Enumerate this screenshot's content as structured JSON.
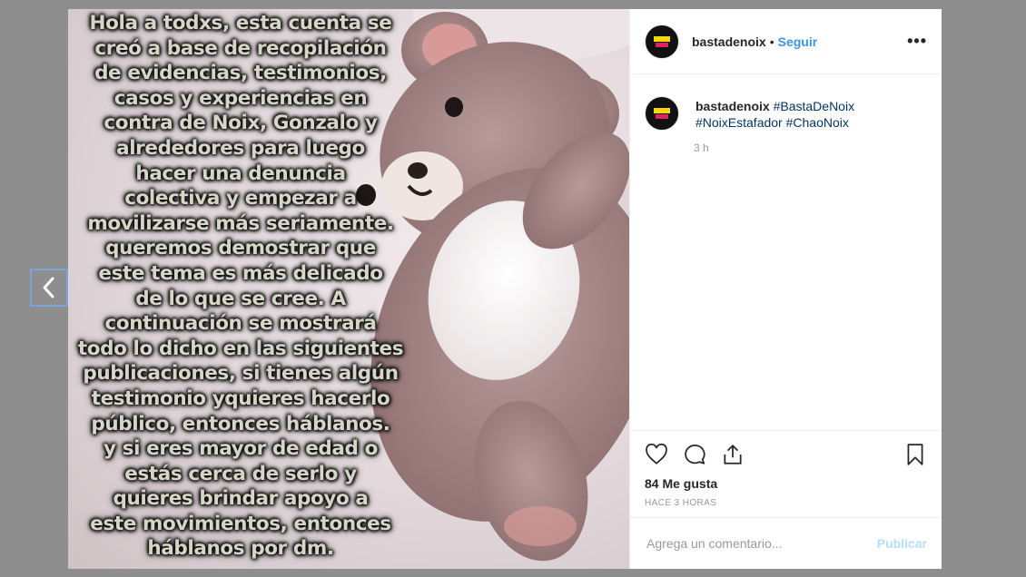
{
  "post": {
    "image_text_lines": [
      "Hola a todxs, esta cuenta se",
      "creó a base de recopilación",
      "de evidencias, testimonios,",
      "casos y experiencias en",
      "contra de Noix, Gonzalo y",
      "alrededores para luego",
      "hacer una denuncia",
      "colectiva y empezar a",
      "movilizarse más seriamente.",
      "queremos demostrar que",
      "este tema es más delicado",
      "de lo que se cree. A",
      "continuación se mostrará",
      "todo lo dicho en las siguientes",
      "publicaciones, si tienes algún",
      "testimonio yquieres hacerlo",
      "público, entonces háblanos.",
      "y si eres mayor de edad o",
      "estás cerca de serlo y",
      "quieres brindar apoyo a",
      "este movimientos, entonces",
      "háblanos por dm."
    ]
  },
  "header": {
    "username": "bastadenoix",
    "separator": "•",
    "follow_label": "Seguir",
    "more_label": "•••"
  },
  "caption": {
    "username": "bastadenoix",
    "tags": [
      "#BastaDeNoix",
      "#NoixEstafador",
      "#ChaoNoix"
    ],
    "time": "3 h"
  },
  "actions": {
    "icons": [
      "heart-icon",
      "comment-icon",
      "share-icon",
      "bookmark-icon"
    ],
    "likes": "84 Me gusta",
    "posted": "HACE 3 HORAS"
  },
  "comment": {
    "placeholder": "Agrega un comentario...",
    "publish_label": "Publicar"
  },
  "nav": {
    "prev_icon": "chevron-left-icon"
  },
  "colors": {
    "backdrop": "#8e8e8e",
    "link_blue": "#3897f0",
    "hashtag": "#003569",
    "publish_disabled": "#b2dffc"
  }
}
